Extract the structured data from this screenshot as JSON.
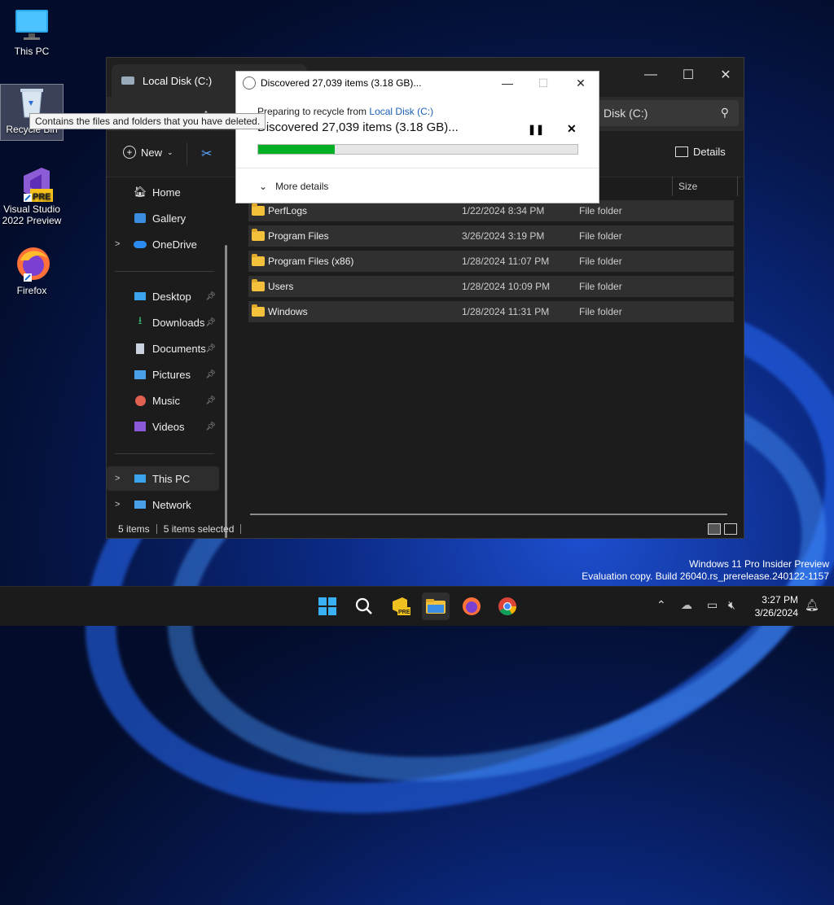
{
  "desktop": {
    "icons": [
      {
        "label": "This PC"
      },
      {
        "label": "Recycle Bin"
      },
      {
        "label": "Visual Studio 2022 Preview"
      },
      {
        "label": "Firefox"
      }
    ],
    "tooltip": "Contains the files and folders that you have deleted."
  },
  "explorer": {
    "tab_title": "Local Disk (C:)",
    "search_placeholder": "Disk (C:)",
    "commands": {
      "new": "New",
      "details": "Details"
    },
    "columns": {
      "size": "Size"
    },
    "sidebar": {
      "top": [
        {
          "label": "Home"
        },
        {
          "label": "Gallery"
        },
        {
          "label": "OneDrive"
        }
      ],
      "quick": [
        {
          "label": "Desktop"
        },
        {
          "label": "Downloads"
        },
        {
          "label": "Documents"
        },
        {
          "label": "Pictures"
        },
        {
          "label": "Music"
        },
        {
          "label": "Videos"
        }
      ],
      "bottom": [
        {
          "label": "This PC"
        },
        {
          "label": "Network"
        }
      ]
    },
    "rows": [
      {
        "name": "PerfLogs",
        "date": "1/22/2024 8:34 PM",
        "type": "File folder"
      },
      {
        "name": "Program Files",
        "date": "3/26/2024 3:19 PM",
        "type": "File folder"
      },
      {
        "name": "Program Files (x86)",
        "date": "1/28/2024 11:07 PM",
        "type": "File folder"
      },
      {
        "name": "Users",
        "date": "1/28/2024 10:09 PM",
        "type": "File folder"
      },
      {
        "name": "Windows",
        "date": "1/28/2024 11:31 PM",
        "type": "File folder"
      }
    ],
    "status": {
      "items": "5 items",
      "selected": "5 items selected"
    }
  },
  "dialog": {
    "title": "Discovered 27,039 items (3.18 GB)...",
    "prep_prefix": "Preparing to recycle from ",
    "prep_link": "Local Disk (C:)",
    "headline": "Discovered 27,039 items (3.18 GB)...",
    "progress_fraction": 0.24,
    "more_details": "More details"
  },
  "watermark": {
    "line1": "Windows 11 Pro Insider Preview",
    "line2": "Evaluation copy. Build 26040.rs_prerelease.240122-1157"
  },
  "taskbar": {
    "time": "3:27 PM",
    "date": "3/26/2024"
  },
  "colors": {
    "accent": "#06b025",
    "link": "#1a5fb4"
  }
}
